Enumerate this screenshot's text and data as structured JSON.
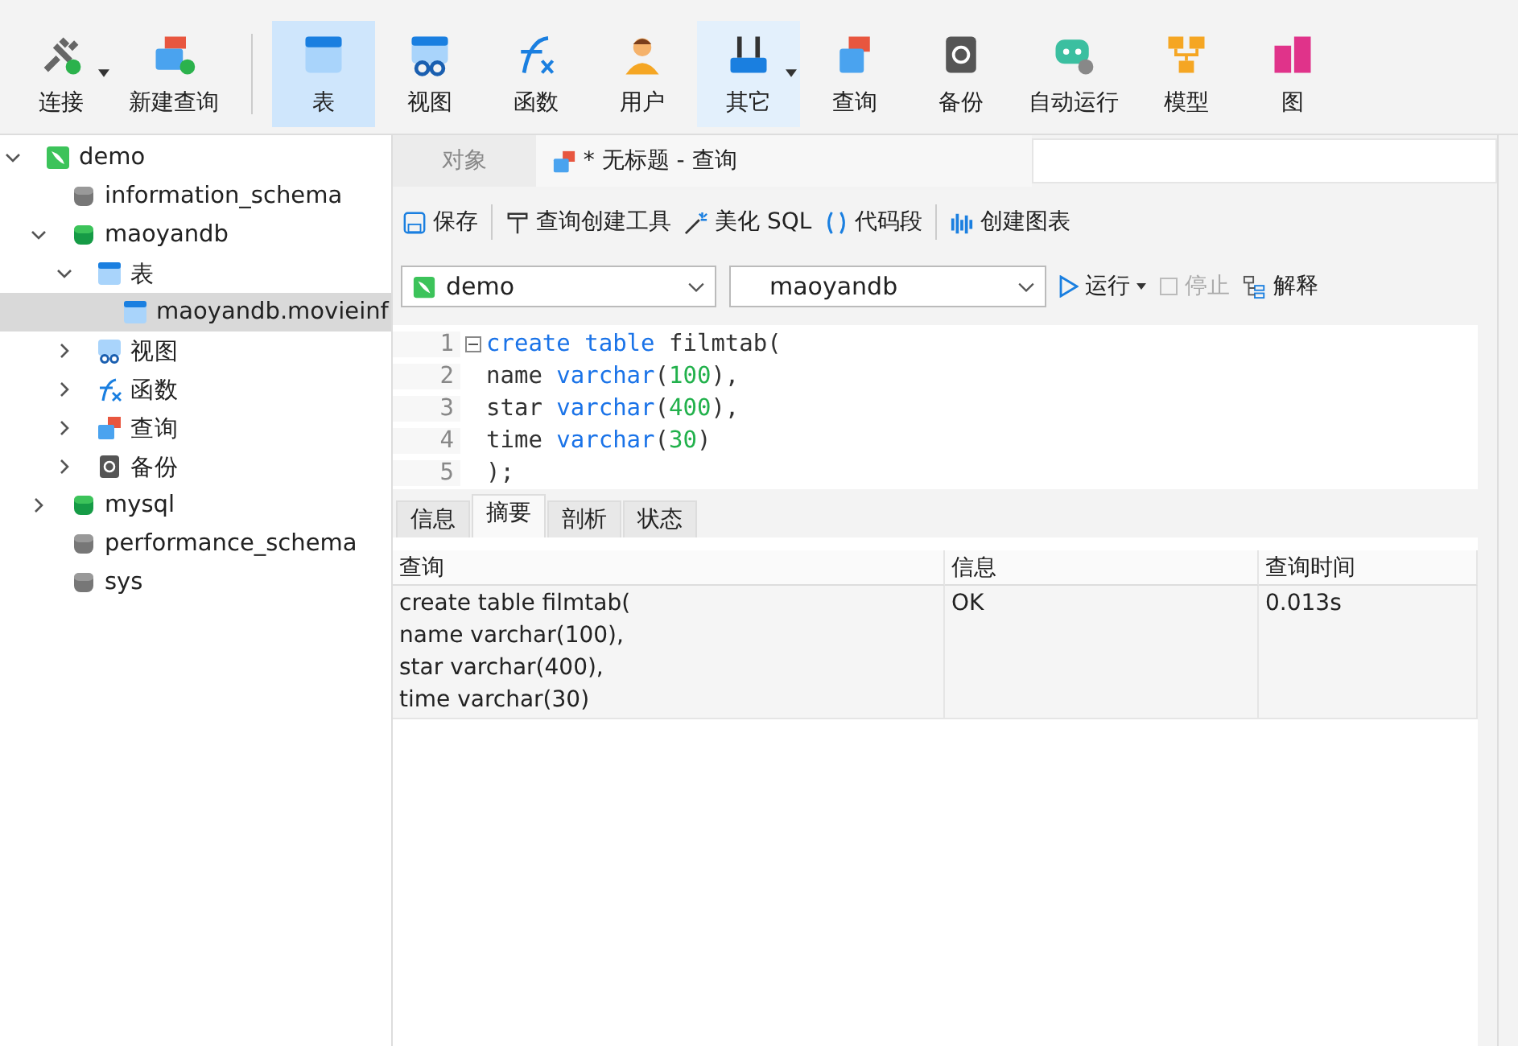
{
  "toolbar": [
    {
      "label": "连接",
      "kind": "connect",
      "selected": false,
      "hover": false,
      "dropdown": true
    },
    {
      "label": "新建查询",
      "kind": "newquery",
      "selected": false,
      "hover": false,
      "dropdown": false
    },
    {
      "label": "表",
      "kind": "table",
      "selected": true,
      "hover": false,
      "dropdown": false
    },
    {
      "label": "视图",
      "kind": "view",
      "selected": false,
      "hover": false,
      "dropdown": false
    },
    {
      "label": "函数",
      "kind": "function",
      "selected": false,
      "hover": false,
      "dropdown": false
    },
    {
      "label": "用户",
      "kind": "user",
      "selected": false,
      "hover": false,
      "dropdown": false
    },
    {
      "label": "其它",
      "kind": "tools",
      "selected": false,
      "hover": true,
      "dropdown": true
    },
    {
      "label": "查询",
      "kind": "query",
      "selected": false,
      "hover": false,
      "dropdown": false
    },
    {
      "label": "备份",
      "kind": "backup",
      "selected": false,
      "hover": false,
      "dropdown": false
    },
    {
      "label": "自动运行",
      "kind": "robot",
      "selected": false,
      "hover": false,
      "dropdown": false
    },
    {
      "label": "模型",
      "kind": "model",
      "selected": false,
      "hover": false,
      "dropdown": false
    },
    {
      "label": "图",
      "kind": "chart",
      "selected": false,
      "hover": false,
      "dropdown": false
    }
  ],
  "tree": [
    {
      "label": "demo",
      "kind": "connection",
      "selected": false,
      "expanded": true,
      "children": [
        {
          "label": "information_schema",
          "kind": "db",
          "selected": false
        },
        {
          "label": "maoyandb",
          "kind": "db-open",
          "selected": false,
          "expanded": true,
          "children": [
            {
              "label": "表",
              "kind": "table",
              "selected": false,
              "expanded": true,
              "children": [
                {
                  "label": "maoyandb.movieinf",
                  "kind": "table",
                  "selected": true
                }
              ]
            },
            {
              "label": "视图",
              "kind": "view",
              "selected": false,
              "expanded": false
            },
            {
              "label": "函数",
              "kind": "function",
              "selected": false,
              "expanded": false
            },
            {
              "label": "查询",
              "kind": "query",
              "selected": false,
              "expanded": false
            },
            {
              "label": "备份",
              "kind": "backup",
              "selected": false,
              "expanded": false
            }
          ]
        },
        {
          "label": "mysql",
          "kind": "db-open",
          "selected": false,
          "expanded": false
        },
        {
          "label": "performance_schema",
          "kind": "db",
          "selected": false
        },
        {
          "label": "sys",
          "kind": "db",
          "selected": false
        }
      ]
    }
  ],
  "tabs": [
    {
      "label": "对象",
      "selected": false
    },
    {
      "label": "* 无标题 - 查询",
      "selected": true
    }
  ],
  "query_toolbar": [
    {
      "label": "保存",
      "kind": "save"
    },
    {
      "label": "查询创建工具",
      "kind": "builder"
    },
    {
      "label": "美化 SQL",
      "kind": "beautify"
    },
    {
      "label": "代码段",
      "kind": "snippet"
    },
    {
      "label": "创建图表",
      "kind": "chart"
    }
  ],
  "connection_select": {
    "value": "demo"
  },
  "database_select": {
    "value": "maoyandb"
  },
  "run_button": {
    "label": "运行"
  },
  "stop_button": {
    "label": "停止",
    "disabled": true
  },
  "explain_button": {
    "label": "解释"
  },
  "editor": {
    "lines": [
      {
        "number": "1",
        "tokens": [
          {
            "text": "create",
            "kind": "keyword"
          },
          {
            "text": " table",
            "kind": "keyword"
          },
          {
            "text": " filmtab(",
            "kind": "plain"
          }
        ]
      },
      {
        "number": "2",
        "tokens": [
          {
            "text": "name ",
            "kind": "plain"
          },
          {
            "text": "varchar",
            "kind": "keyword"
          },
          {
            "text": "(",
            "kind": "plain"
          },
          {
            "text": "100",
            "kind": "number"
          },
          {
            "text": "),",
            "kind": "plain"
          }
        ]
      },
      {
        "number": "3",
        "tokens": [
          {
            "text": "star ",
            "kind": "plain"
          },
          {
            "text": "varchar",
            "kind": "keyword"
          },
          {
            "text": "(",
            "kind": "plain"
          },
          {
            "text": "400",
            "kind": "number"
          },
          {
            "text": "),",
            "kind": "plain"
          }
        ]
      },
      {
        "number": "4",
        "tokens": [
          {
            "text": "time ",
            "kind": "plain"
          },
          {
            "text": "varchar",
            "kind": "keyword"
          },
          {
            "text": "(",
            "kind": "plain"
          },
          {
            "text": "30",
            "kind": "number"
          },
          {
            "text": ")",
            "kind": "plain"
          }
        ]
      },
      {
        "number": "5",
        "tokens": [
          {
            "text": ");",
            "kind": "plain"
          }
        ]
      }
    ]
  },
  "result_tabs": [
    {
      "label": "信息",
      "selected": false
    },
    {
      "label": "摘要",
      "selected": true
    },
    {
      "label": "剖析",
      "selected": false
    },
    {
      "label": "状态",
      "selected": false
    }
  ],
  "result_table": {
    "columns": [
      "查询",
      "信息",
      "查询时间"
    ],
    "rows": [
      [
        "create table filmtab(\nname varchar(100),\nstar varchar(400),\ntime varchar(30)",
        "OK",
        "0.013s"
      ]
    ]
  }
}
